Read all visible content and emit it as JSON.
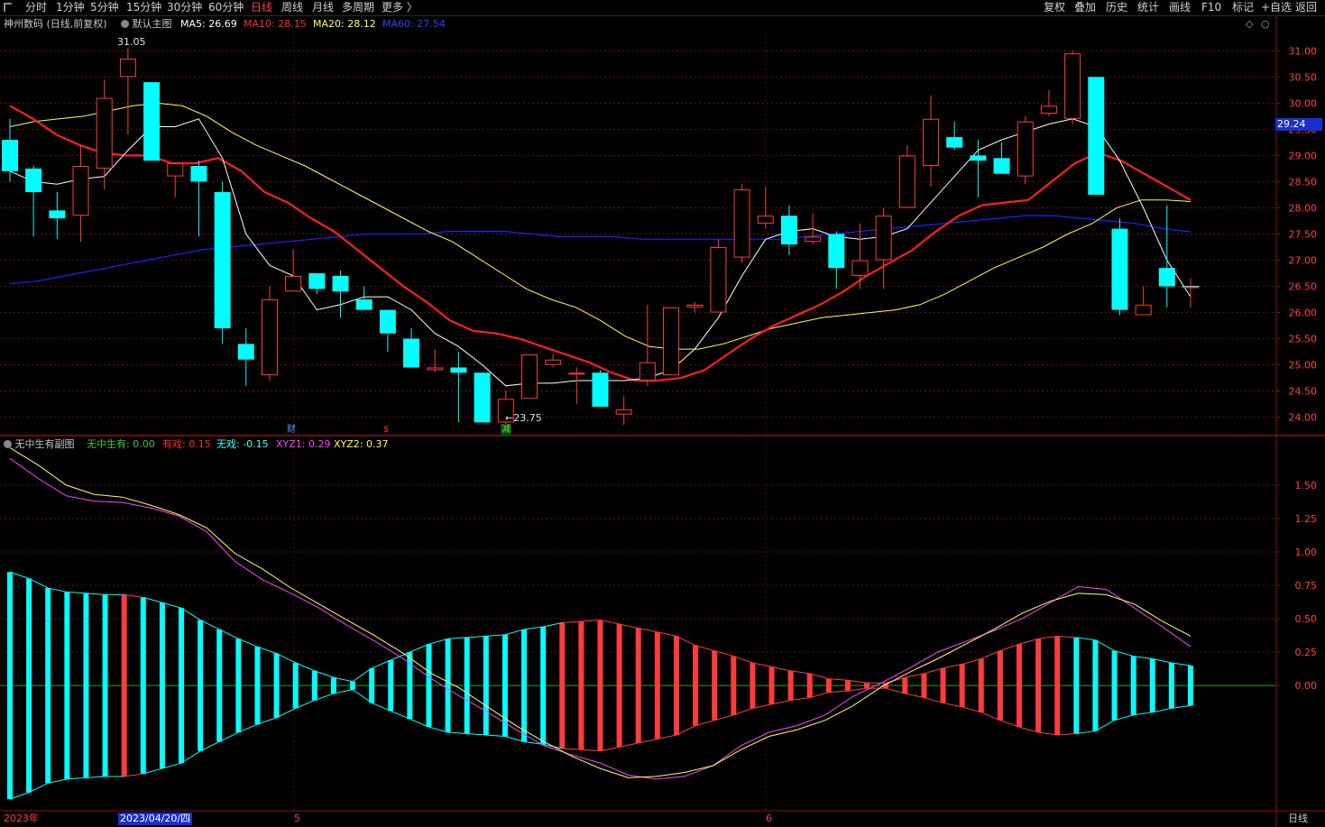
{
  "toolbar": {
    "left_items": [
      {
        "label": "分时"
      },
      {
        "label": "1分钟"
      },
      {
        "label": "5分钟"
      },
      {
        "label": "15分钟"
      },
      {
        "label": "30分钟"
      },
      {
        "label": "60分钟"
      },
      {
        "label": "日线"
      },
      {
        "label": "周线"
      },
      {
        "label": "月线"
      },
      {
        "label": "多周期"
      },
      {
        "label": "更多 〉"
      }
    ],
    "active_label": "日线",
    "right_items": [
      {
        "label": "复权"
      },
      {
        "label": "叠加"
      },
      {
        "label": "历史"
      },
      {
        "label": "统计"
      },
      {
        "label": "画线"
      },
      {
        "label": "F10"
      },
      {
        "label": "标记"
      },
      {
        "label": "+自选"
      },
      {
        "label": "返回"
      }
    ],
    "menu_icon": "tab-corner-icon"
  },
  "main_panel": {
    "stock_title": "神州数码 (日线,前复权)",
    "template_label": "默认主图",
    "ma_labels": [
      {
        "text": "MA5: 26.69",
        "color": "#ffffff"
      },
      {
        "text": "MA10: 28.15",
        "color": "#ff2a2a"
      },
      {
        "text": "MA20: 28.12",
        "color": "#ffff55"
      },
      {
        "text": "MA60: 27.54",
        "color": "#3b3bff"
      }
    ],
    "high_label": "31.05",
    "low_label": "23.75",
    "current_price": "29.24",
    "event_markers": [
      {
        "text": "财",
        "color": "#4aa3ff"
      },
      {
        "text": "$",
        "color": "#ff3030"
      },
      {
        "text": "减",
        "color": "#44ff44"
      }
    ],
    "diamond_icon": "diamond-icon",
    "y_ticks": [
      "31.00",
      "30.50",
      "30.00",
      "29.50",
      "29.00",
      "28.50",
      "28.00",
      "27.50",
      "27.00",
      "26.50",
      "26.00",
      "25.50",
      "25.00",
      "24.50",
      "24.00"
    ]
  },
  "sub_panel": {
    "indicator_name": "无中生有副图",
    "labels": [
      {
        "text": "无中生有: 0.00",
        "color": "#33cc33"
      },
      {
        "text": "有戏: 0.15",
        "color": "#ff2a2a"
      },
      {
        "text": "无戏: -0.15",
        "color": "#44ffff"
      },
      {
        "text": "XYZ1: 0.29",
        "color": "#ff44ff"
      },
      {
        "text": "XYZ2: 0.37",
        "color": "#ffff44"
      }
    ],
    "y_ticks": [
      "1.50",
      "1.25",
      "1.00",
      "0.75",
      "0.50",
      "0.25",
      "0.00"
    ]
  },
  "xaxis": {
    "year_label": "2023年",
    "cursor_date": "2023/04/20/四",
    "month_labels": [
      "5",
      "6"
    ],
    "period_label": "日线"
  },
  "colors": {
    "up": "#ff3b3b",
    "down": "#00ffff",
    "grid": "#8a1010",
    "ma5": "#ffffff",
    "ma10": "#ff2020",
    "ma20": "#ffff55",
    "ma60": "#2020ff",
    "xyz1": "#ff44ff",
    "xyz2": "#ffff66"
  },
  "chart_data": {
    "type": "candlestick",
    "candles": [
      {
        "o": 29.3,
        "h": 29.7,
        "c": 28.7,
        "l": 28.5
      },
      {
        "o": 28.75,
        "h": 28.8,
        "c": 28.3,
        "l": 27.45
      },
      {
        "o": 27.95,
        "h": 28.3,
        "c": 27.8,
        "l": 27.4
      },
      {
        "o": 27.85,
        "h": 29.2,
        "c": 28.8,
        "l": 27.35
      },
      {
        "o": 28.75,
        "h": 30.45,
        "c": 30.1,
        "l": 28.35
      },
      {
        "o": 30.5,
        "h": 31.05,
        "c": 30.85,
        "l": 29.4
      },
      {
        "o": 30.4,
        "h": 30.4,
        "c": 28.9,
        "l": 28.9
      },
      {
        "o": 28.6,
        "h": 28.85,
        "c": 28.85,
        "l": 28.2
      },
      {
        "o": 28.8,
        "h": 28.9,
        "c": 28.5,
        "l": 27.45
      },
      {
        "o": 28.3,
        "h": 28.5,
        "c": 25.7,
        "l": 25.4
      },
      {
        "o": 25.4,
        "h": 25.7,
        "c": 25.1,
        "l": 24.6
      },
      {
        "o": 24.8,
        "h": 26.5,
        "c": 26.25,
        "l": 24.7
      },
      {
        "o": 26.4,
        "h": 27.2,
        "c": 26.7,
        "l": 26.4
      },
      {
        "o": 26.75,
        "h": 26.75,
        "c": 26.45,
        "l": 26.35
      },
      {
        "o": 26.7,
        "h": 26.8,
        "c": 26.4,
        "l": 25.9
      },
      {
        "o": 26.25,
        "h": 26.5,
        "c": 26.05,
        "l": 26.1
      },
      {
        "o": 26.05,
        "h": 26.05,
        "c": 25.6,
        "l": 25.25
      },
      {
        "o": 25.5,
        "h": 25.7,
        "c": 24.95,
        "l": 24.95
      },
      {
        "o": 24.9,
        "h": 25.3,
        "c": 24.95,
        "l": 24.85
      },
      {
        "o": 24.95,
        "h": 25.25,
        "c": 24.85,
        "l": 23.9
      },
      {
        "o": 24.85,
        "h": 24.85,
        "c": 23.9,
        "l": 23.9
      },
      {
        "o": 23.9,
        "h": 24.5,
        "c": 24.35,
        "l": 23.75
      },
      {
        "o": 24.35,
        "h": 25.2,
        "c": 25.2,
        "l": 24.35
      },
      {
        "o": 25.0,
        "h": 25.2,
        "c": 25.1,
        "l": 24.95
      },
      {
        "o": 24.85,
        "h": 24.95,
        "c": 24.85,
        "l": 24.25
      },
      {
        "o": 24.85,
        "h": 24.9,
        "c": 24.2,
        "l": 24.2
      },
      {
        "o": 24.05,
        "h": 24.4,
        "c": 24.15,
        "l": 23.85
      },
      {
        "o": 24.7,
        "h": 26.15,
        "c": 25.05,
        "l": 24.6
      },
      {
        "o": 24.8,
        "h": 26.1,
        "c": 26.1,
        "l": 24.8
      },
      {
        "o": 26.1,
        "h": 26.2,
        "c": 26.15,
        "l": 26.0
      },
      {
        "o": 26.0,
        "h": 27.4,
        "c": 27.25,
        "l": 26.0
      },
      {
        "o": 27.05,
        "h": 28.45,
        "c": 28.35,
        "l": 26.95
      },
      {
        "o": 27.7,
        "h": 28.4,
        "c": 27.85,
        "l": 27.6
      },
      {
        "o": 27.85,
        "h": 28.05,
        "c": 27.3,
        "l": 27.1
      },
      {
        "o": 27.35,
        "h": 27.9,
        "c": 27.45,
        "l": 27.3
      },
      {
        "o": 27.5,
        "h": 27.55,
        "c": 26.85,
        "l": 26.45
      },
      {
        "o": 26.7,
        "h": 27.7,
        "c": 27.0,
        "l": 26.45
      },
      {
        "o": 27.0,
        "h": 28.0,
        "c": 27.85,
        "l": 26.45
      },
      {
        "o": 28.0,
        "h": 29.2,
        "c": 29.0,
        "l": 28.0
      },
      {
        "o": 28.8,
        "h": 30.15,
        "c": 29.7,
        "l": 28.4
      },
      {
        "o": 29.35,
        "h": 29.65,
        "c": 29.15,
        "l": 29.1
      },
      {
        "o": 29.0,
        "h": 29.3,
        "c": 28.9,
        "l": 28.2
      },
      {
        "o": 28.95,
        "h": 29.25,
        "c": 28.65,
        "l": 28.65
      },
      {
        "o": 28.6,
        "h": 29.75,
        "c": 29.65,
        "l": 28.45
      },
      {
        "o": 29.8,
        "h": 30.25,
        "c": 29.95,
        "l": 29.75
      },
      {
        "o": 29.7,
        "h": 31.0,
        "c": 30.95,
        "l": 29.6
      },
      {
        "o": 30.5,
        "h": 30.5,
        "c": 28.25,
        "l": 28.25
      },
      {
        "o": 27.6,
        "h": 27.8,
        "c": 26.05,
        "l": 25.95
      },
      {
        "o": 25.95,
        "h": 26.5,
        "c": 26.15,
        "l": 25.95
      },
      {
        "o": 26.85,
        "h": 28.05,
        "c": 26.5,
        "l": 26.1
      },
      {
        "o": 26.5,
        "h": 26.65,
        "c": 26.5,
        "l": 26.1
      }
    ],
    "ma5": [
      28.7,
      28.5,
      28.45,
      28.55,
      28.6,
      29.1,
      29.55,
      29.55,
      29.7,
      28.95,
      27.5,
      26.9,
      26.7,
      26.05,
      26.15,
      26.3,
      26.3,
      26.05,
      25.6,
      25.35,
      25.0,
      24.6,
      24.65,
      24.65,
      24.7,
      24.7,
      24.7,
      24.75,
      24.9,
      25.3,
      25.9,
      26.7,
      27.4,
      27.55,
      27.6,
      27.45,
      27.4,
      27.45,
      27.6,
      28.1,
      28.6,
      29.1,
      29.3,
      29.45,
      29.6,
      29.7,
      29.55,
      28.9,
      28.0,
      27.0,
      26.3
    ],
    "ma10": [
      29.95,
      29.7,
      29.4,
      29.2,
      29.05,
      29.0,
      29.0,
      28.85,
      28.85,
      28.95,
      28.7,
      28.3,
      28.1,
      27.8,
      27.55,
      27.2,
      26.85,
      26.5,
      26.2,
      25.85,
      25.65,
      25.6,
      25.5,
      25.35,
      25.2,
      25.05,
      24.85,
      24.7,
      24.7,
      24.75,
      24.9,
      25.2,
      25.5,
      25.75,
      25.95,
      26.15,
      26.4,
      26.7,
      26.95,
      27.2,
      27.55,
      27.85,
      28.05,
      28.1,
      28.15,
      28.5,
      28.85,
      29.05,
      28.9,
      28.65,
      28.4,
      28.15
    ],
    "ma20": [
      29.55,
      29.65,
      29.7,
      29.75,
      29.85,
      29.95,
      30.0,
      29.95,
      29.75,
      29.45,
      29.2,
      29.0,
      28.8,
      28.55,
      28.3,
      28.05,
      27.8,
      27.55,
      27.35,
      27.05,
      26.75,
      26.45,
      26.25,
      26.1,
      25.85,
      25.55,
      25.35,
      25.3,
      25.3,
      25.4,
      25.55,
      25.7,
      25.8,
      25.9,
      25.95,
      26.0,
      26.05,
      26.15,
      26.35,
      26.6,
      26.85,
      27.05,
      27.25,
      27.5,
      27.7,
      28.0,
      28.15,
      28.15,
      28.12
    ],
    "ma60": [
      26.55,
      26.6,
      26.7,
      26.8,
      26.9,
      27.0,
      27.1,
      27.2,
      27.25,
      27.3,
      27.35,
      27.4,
      27.45,
      27.5,
      27.5,
      27.5,
      27.55,
      27.55,
      27.55,
      27.5,
      27.45,
      27.45,
      27.45,
      27.4,
      27.4,
      27.4,
      27.4,
      27.4,
      27.4,
      27.45,
      27.5,
      27.55,
      27.6,
      27.65,
      27.7,
      27.75,
      27.8,
      27.85,
      27.85,
      27.8,
      27.75,
      27.7,
      27.6,
      27.54
    ],
    "sub_hist": [
      -0.85,
      -0.8,
      -0.73,
      -0.7,
      -0.69,
      -0.68,
      -0.68,
      -0.66,
      -0.62,
      -0.58,
      -0.49,
      -0.42,
      -0.35,
      -0.29,
      -0.24,
      -0.17,
      -0.11,
      -0.06,
      0.03,
      0.13,
      0.19,
      0.25,
      0.31,
      0.35,
      0.36,
      0.37,
      0.38,
      0.42,
      0.44,
      0.47,
      0.48,
      0.49,
      0.46,
      0.43,
      0.4,
      0.37,
      0.3,
      0.26,
      0.22,
      0.17,
      0.14,
      0.11,
      0.09,
      0.05,
      0.04,
      0.02,
      -0.02,
      -0.06,
      -0.09,
      -0.13,
      -0.16,
      -0.2,
      -0.26,
      -0.31,
      -0.35,
      -0.37,
      -0.36,
      -0.34,
      -0.26,
      -0.22,
      -0.2,
      -0.17,
      -0.15
    ],
    "xyz1": [
      1.7,
      1.55,
      1.42,
      1.38,
      1.37,
      1.33,
      1.27,
      1.15,
      0.93,
      0.79,
      0.69,
      0.58,
      0.45,
      0.33,
      0.2,
      0.05,
      -0.08,
      -0.2,
      -0.33,
      -0.45,
      -0.52,
      -0.58,
      -0.67,
      -0.7,
      -0.68,
      -0.6,
      -0.45,
      -0.35,
      -0.3,
      -0.22,
      -0.08,
      0.02,
      0.13,
      0.25,
      0.33,
      0.41,
      0.5,
      0.62,
      0.74,
      0.72,
      0.58,
      0.44,
      0.29
    ],
    "xyz2": [
      1.78,
      1.65,
      1.5,
      1.43,
      1.41,
      1.35,
      1.28,
      1.18,
      0.99,
      0.87,
      0.73,
      0.61,
      0.49,
      0.37,
      0.24,
      0.09,
      -0.02,
      -0.16,
      -0.3,
      -0.42,
      -0.53,
      -0.62,
      -0.69,
      -0.68,
      -0.65,
      -0.6,
      -0.48,
      -0.38,
      -0.33,
      -0.26,
      -0.15,
      -0.01,
      0.1,
      0.2,
      0.31,
      0.42,
      0.54,
      0.63,
      0.69,
      0.68,
      0.61,
      0.48,
      0.37
    ],
    "price_range": [
      23.7,
      31.35
    ],
    "sub_range": [
      -0.93,
      1.85
    ]
  }
}
